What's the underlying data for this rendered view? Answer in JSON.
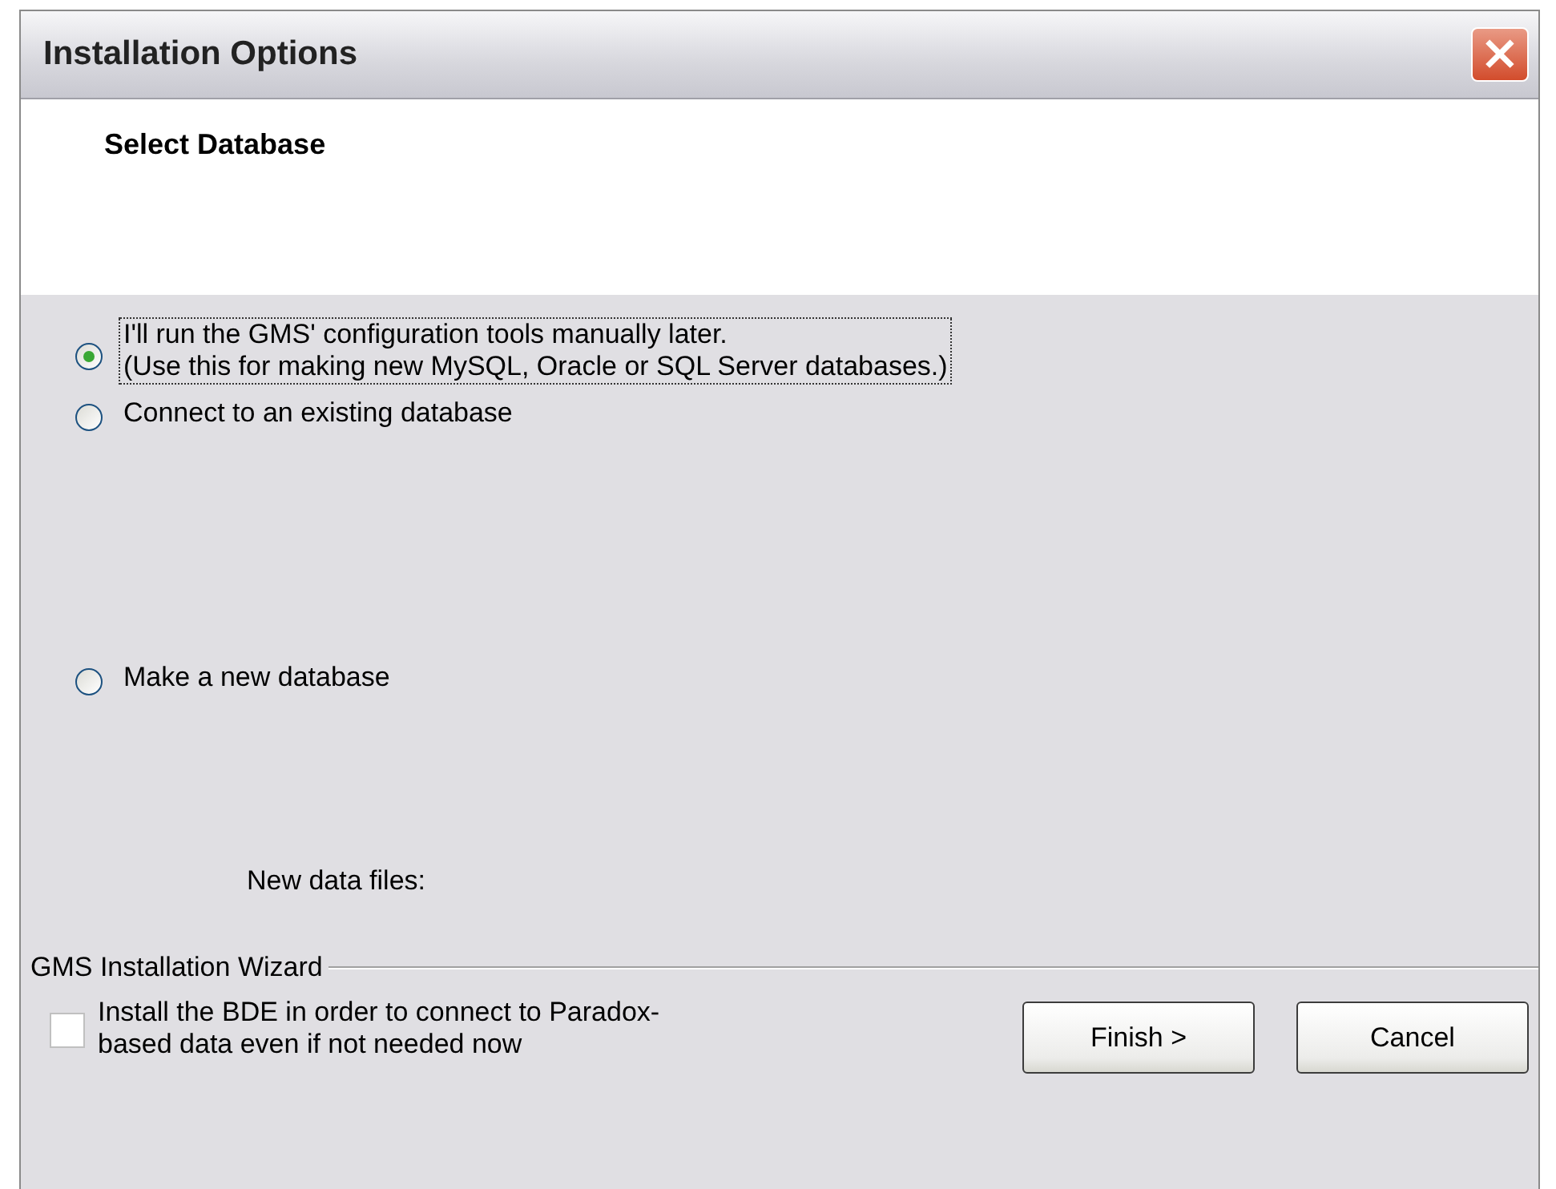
{
  "window": {
    "title": "Installation Options",
    "close": "×"
  },
  "header": {
    "title": "Select Database"
  },
  "options": [
    {
      "label": "I'll run the GMS' configuration tools manually later.\n(Use this for making new MySQL, Oracle or SQL Server databases.)",
      "selected": true,
      "focused": true
    },
    {
      "label": "Connect to an existing database",
      "selected": false,
      "focused": false
    },
    {
      "label": "Make a new database",
      "selected": false,
      "focused": false
    }
  ],
  "new_data_files_label": "New data files:",
  "group_label": "GMS Installation Wizard",
  "bde_checkbox": {
    "label": "Install the BDE in order to connect to Paradox-\nbased data even if not needed now",
    "checked": false
  },
  "buttons": [
    "Finish >",
    "Cancel"
  ]
}
